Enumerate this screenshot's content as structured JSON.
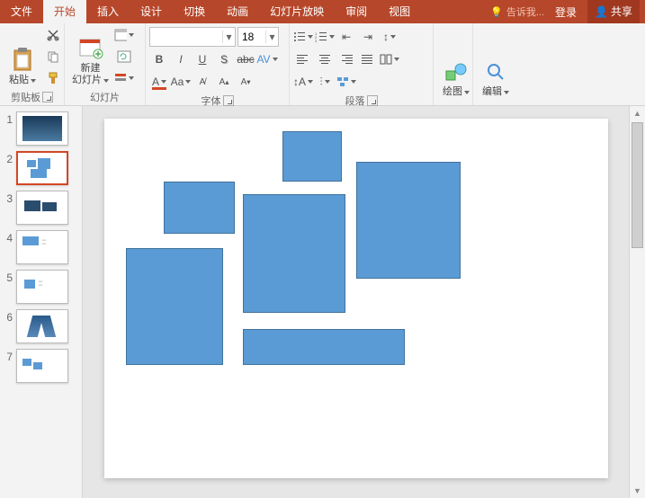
{
  "tabs": {
    "file": "文件",
    "home": "开始",
    "insert": "插入",
    "design": "设计",
    "transitions": "切换",
    "animations": "动画",
    "slideshow": "幻灯片放映",
    "review": "审阅",
    "view": "视图",
    "tell_me": "告诉我...",
    "login": "登录",
    "share": "共享"
  },
  "ribbon": {
    "clipboard_label": "剪贴板",
    "paste": "粘贴",
    "slides_label": "幻灯片",
    "new_slide": "新建\n幻灯片",
    "font_label": "字体",
    "font_name": "",
    "font_size": "18",
    "paragraph_label": "段落",
    "drawing": "绘图",
    "editing": "编辑"
  },
  "thumbs": [
    "1",
    "2",
    "3",
    "4",
    "5",
    "6",
    "7"
  ]
}
